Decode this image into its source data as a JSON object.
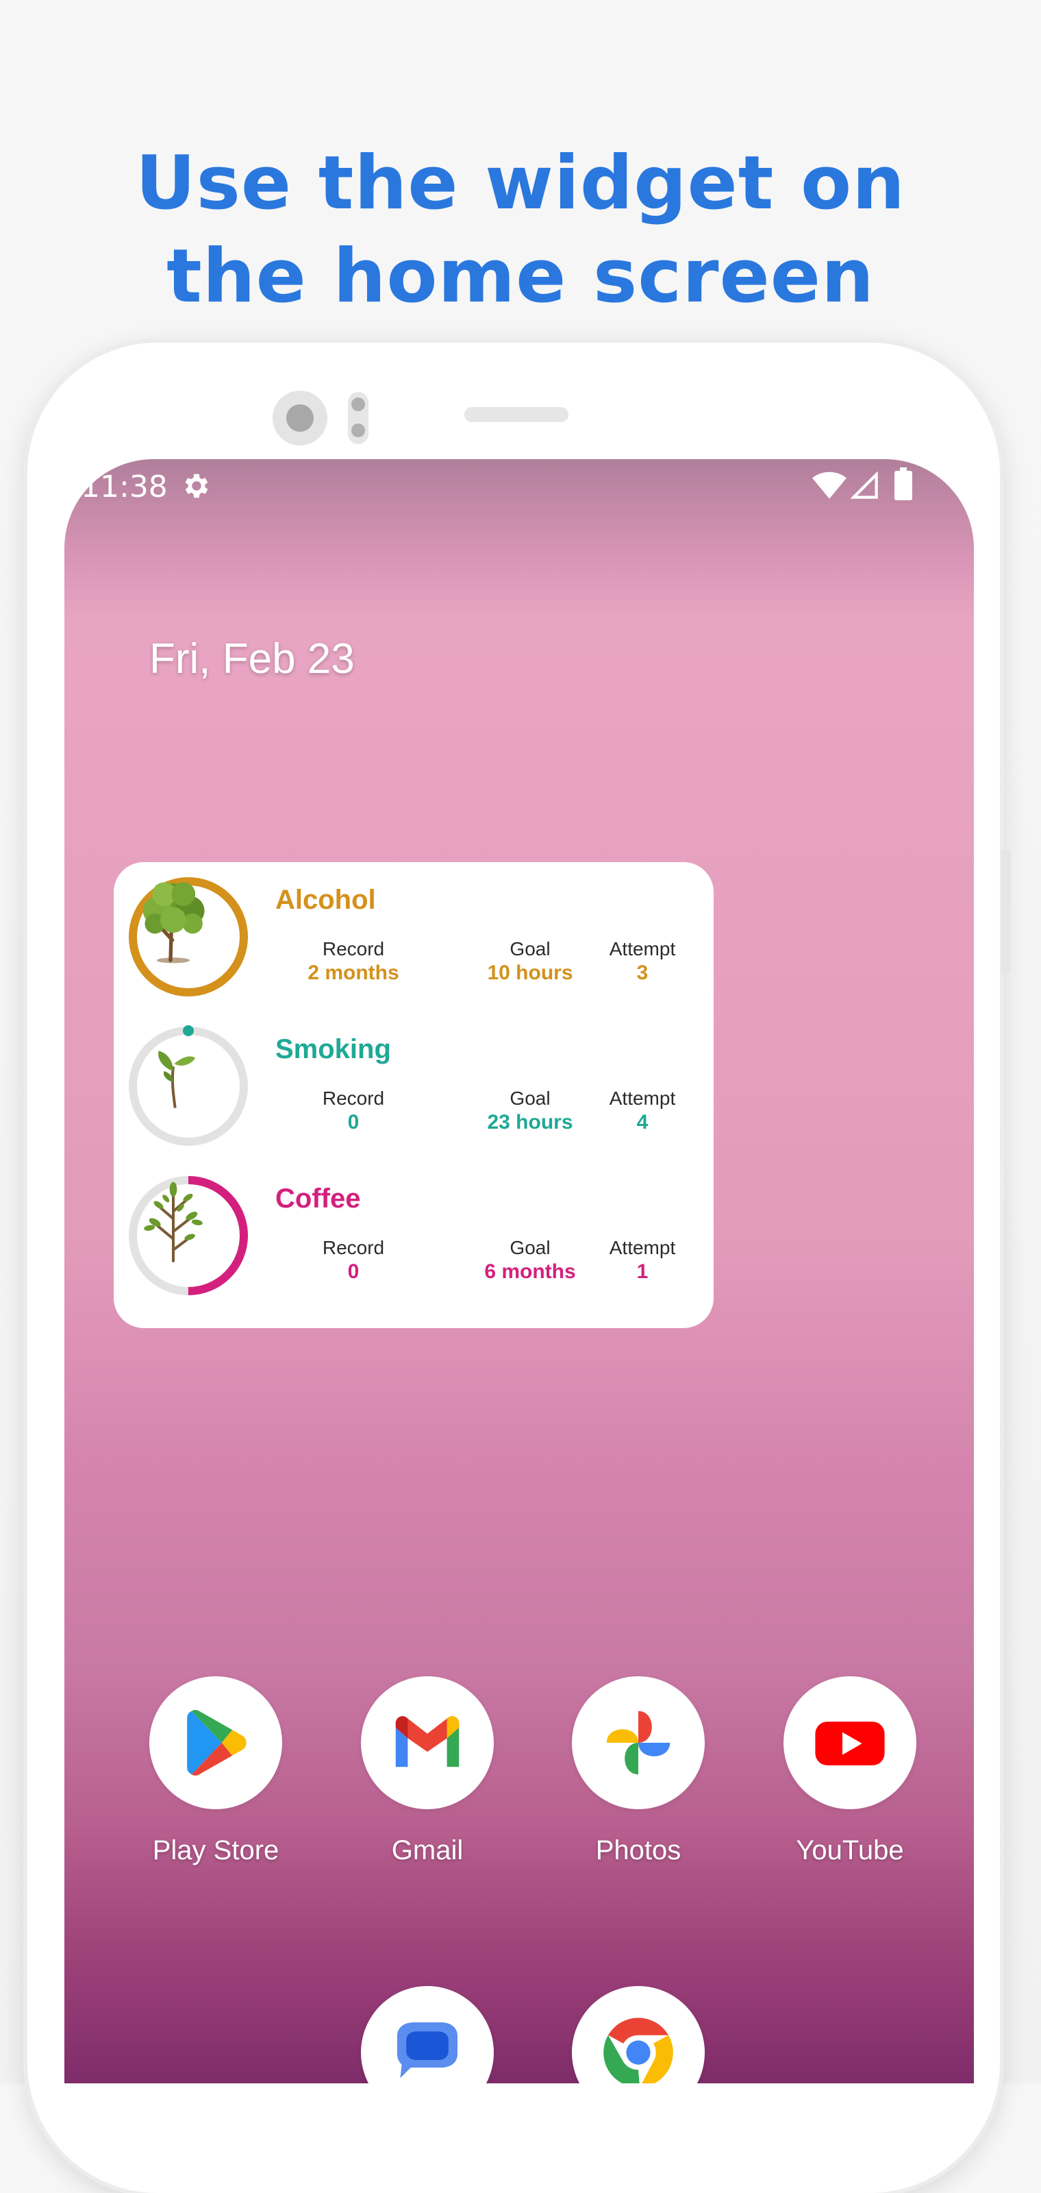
{
  "headline": {
    "line1": "Use the widget on",
    "line2": "the home screen"
  },
  "status_bar": {
    "time": "11:38",
    "icons": [
      "settings-icon",
      "wifi-icon",
      "signal-icon",
      "battery-icon"
    ]
  },
  "home": {
    "date": "Fri, Feb 23"
  },
  "widget": {
    "habits": [
      {
        "name": "Alcohol",
        "color": "#d4911b",
        "progress": 1.0,
        "plant": "tree",
        "record_label": "Record",
        "record": "2 months",
        "goal_label": "Goal",
        "goal": "10 hours",
        "attempt_label": "Attempt",
        "attempt": "3"
      },
      {
        "name": "Smoking",
        "color": "#1fa896",
        "progress": 0.0,
        "plant": "sprout",
        "record_label": "Record",
        "record": "0",
        "goal_label": "Goal",
        "goal": "23 hours",
        "attempt_label": "Attempt",
        "attempt": "4"
      },
      {
        "name": "Coffee",
        "color": "#d3207e",
        "progress": 0.5,
        "plant": "sapling",
        "record_label": "Record",
        "record": "0",
        "goal_label": "Goal",
        "goal": "6 months",
        "attempt_label": "Attempt",
        "attempt": "1"
      }
    ]
  },
  "apps": [
    {
      "label": "Play Store",
      "icon": "play-store-icon"
    },
    {
      "label": "Gmail",
      "icon": "gmail-icon"
    },
    {
      "label": "Photos",
      "icon": "photos-icon"
    },
    {
      "label": "YouTube",
      "icon": "youtube-icon"
    }
  ],
  "dock_apps": [
    {
      "icon": "messages-icon"
    },
    {
      "icon": "chrome-icon"
    }
  ]
}
